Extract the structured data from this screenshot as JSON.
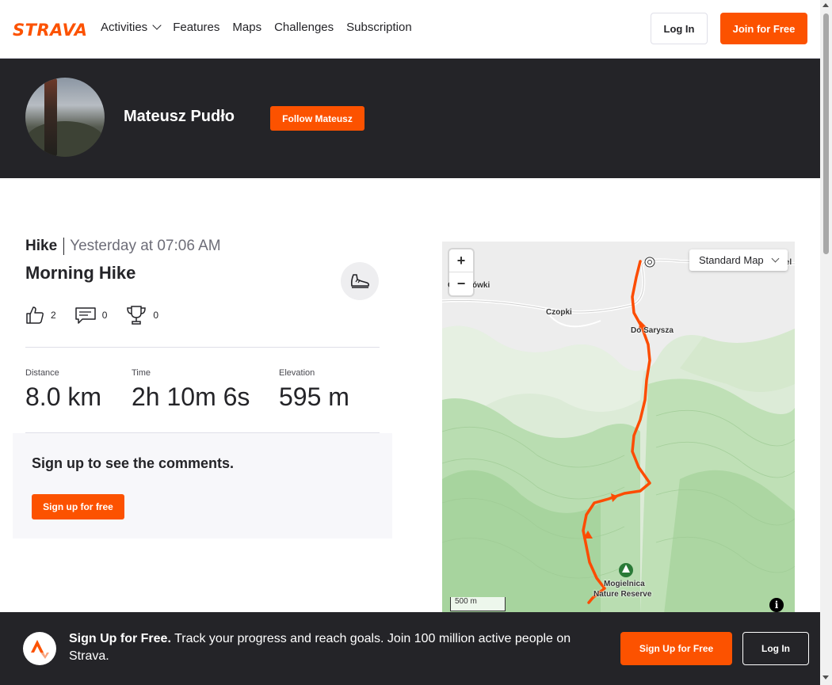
{
  "nav": {
    "logo": "STRAVA",
    "links": [
      "Activities",
      "Features",
      "Maps",
      "Challenges",
      "Subscription"
    ],
    "login_label": "Log In",
    "join_label": "Join for Free"
  },
  "athlete": {
    "name": "Mateusz Pudło",
    "follow_label": "Follow Mateusz"
  },
  "activity": {
    "type": "Hike",
    "date": "Yesterday at 07:06 AM",
    "title": "Morning Hike",
    "kudos": "2",
    "comments": "0",
    "achievements": "0",
    "stats": [
      {
        "label": "Distance",
        "value": "8.0 km"
      },
      {
        "label": "Time",
        "value": "2h 10m 6s"
      },
      {
        "label": "Elevation",
        "value": "595 m"
      }
    ]
  },
  "comments": {
    "title": "Sign up to see the comments.",
    "button": "Sign up for free"
  },
  "map": {
    "zoom_in": "+",
    "zoom_out": "−",
    "style_select": "Standard Map",
    "scale": "500 m",
    "labels": [
      "Czopki",
      "Do Sarysza",
      "Mogielnica",
      "Nature Reserve",
      "C",
      "ówki",
      "iel"
    ],
    "route_color": "#fc4c02"
  },
  "banner": {
    "bold": "Sign Up for Free.",
    "text": " Track your progress and reach goals. Join 100 million active people on Strava.",
    "signup_label": "Sign Up for Free",
    "login_label": "Log In"
  },
  "colors": {
    "brand": "#fc5200",
    "dark": "#242428"
  }
}
